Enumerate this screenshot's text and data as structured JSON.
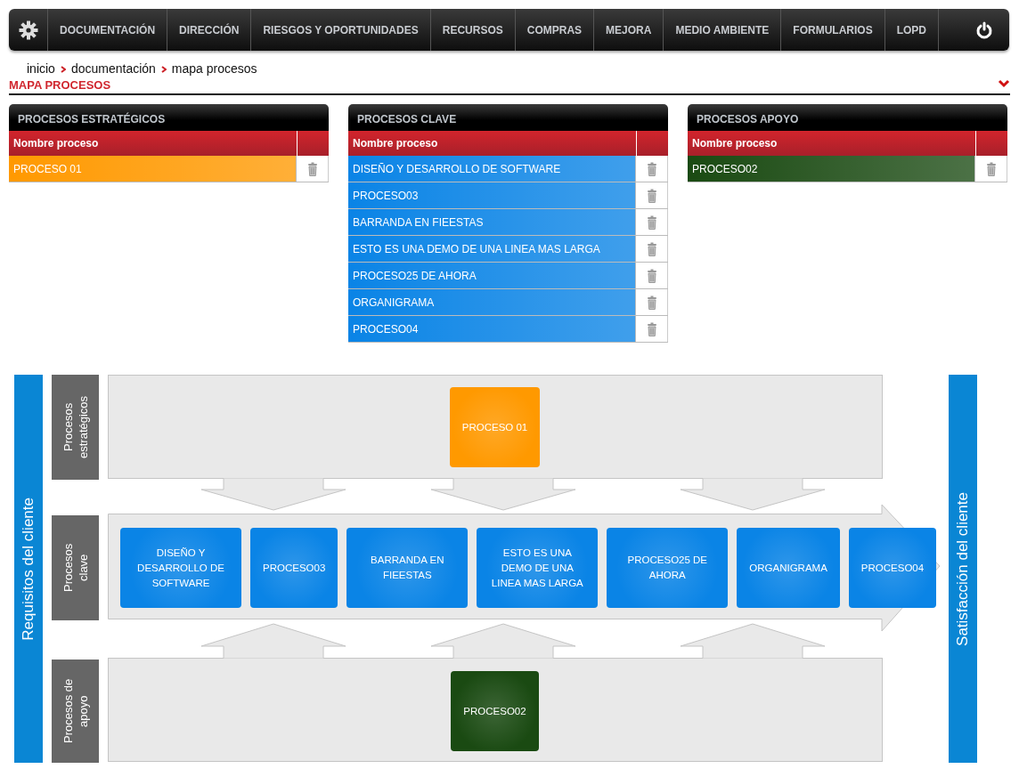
{
  "nav": {
    "items": [
      "DOCUMENTACIÓN",
      "DIRECCIÓN",
      "RIESGOS Y OPORTUNIDADES",
      "RECURSOS",
      "COMPRAS",
      "MEJORA",
      "MEDIO AMBIENTE",
      "FORMULARIOS",
      "LOPD"
    ]
  },
  "breadcrumb": [
    "inicio",
    "documentación",
    "mapa procesos"
  ],
  "page_title": "MAPA PROCESOS",
  "panels": [
    {
      "title": "PROCESOS ESTRATÉGICOS",
      "column": "Nombre proceso",
      "color": "#ff9900",
      "rows": [
        "PROCESO 01"
      ]
    },
    {
      "title": "PROCESOS CLAVE",
      "column": "Nombre proceso",
      "color": "#0a84e6",
      "rows": [
        "DISEÑO Y DESARROLLO DE SOFTWARE",
        "PROCESO03",
        "BARRANDA EN FIEESTAS",
        "ESTO ES UNA DEMO DE UNA LINEA MAS LARGA",
        "PROCESO25 DE AHORA",
        "ORGANIGRAMA",
        "PROCESO04"
      ]
    },
    {
      "title": "PROCESOS APOYO",
      "column": "Nombre proceso",
      "color": "#1a4a12",
      "rows": [
        "PROCESO02"
      ]
    }
  ],
  "map": {
    "left_label": "Requisitos del cliente",
    "right_label": "Satisfacción del cliente",
    "lanes": [
      {
        "label": "Procesos estratégicos",
        "color": "#ff9900",
        "processes": [
          "PROCESO 01"
        ]
      },
      {
        "label": "Procesos clave",
        "color": "#0a84e6",
        "processes": [
          "DISEÑO Y DESARROLLO DE SOFTWARE",
          "PROCESO03",
          "BARRANDA EN FIEESTAS",
          "ESTO ES UNA DEMO DE UNA LINEA MAS LARGA",
          "PROCESO25 DE AHORA",
          "ORGANIGRAMA",
          "PROCESO04"
        ]
      },
      {
        "label": "Procesos de apoyo",
        "color": "#1a4a12",
        "processes": [
          "PROCESO02"
        ]
      }
    ]
  }
}
